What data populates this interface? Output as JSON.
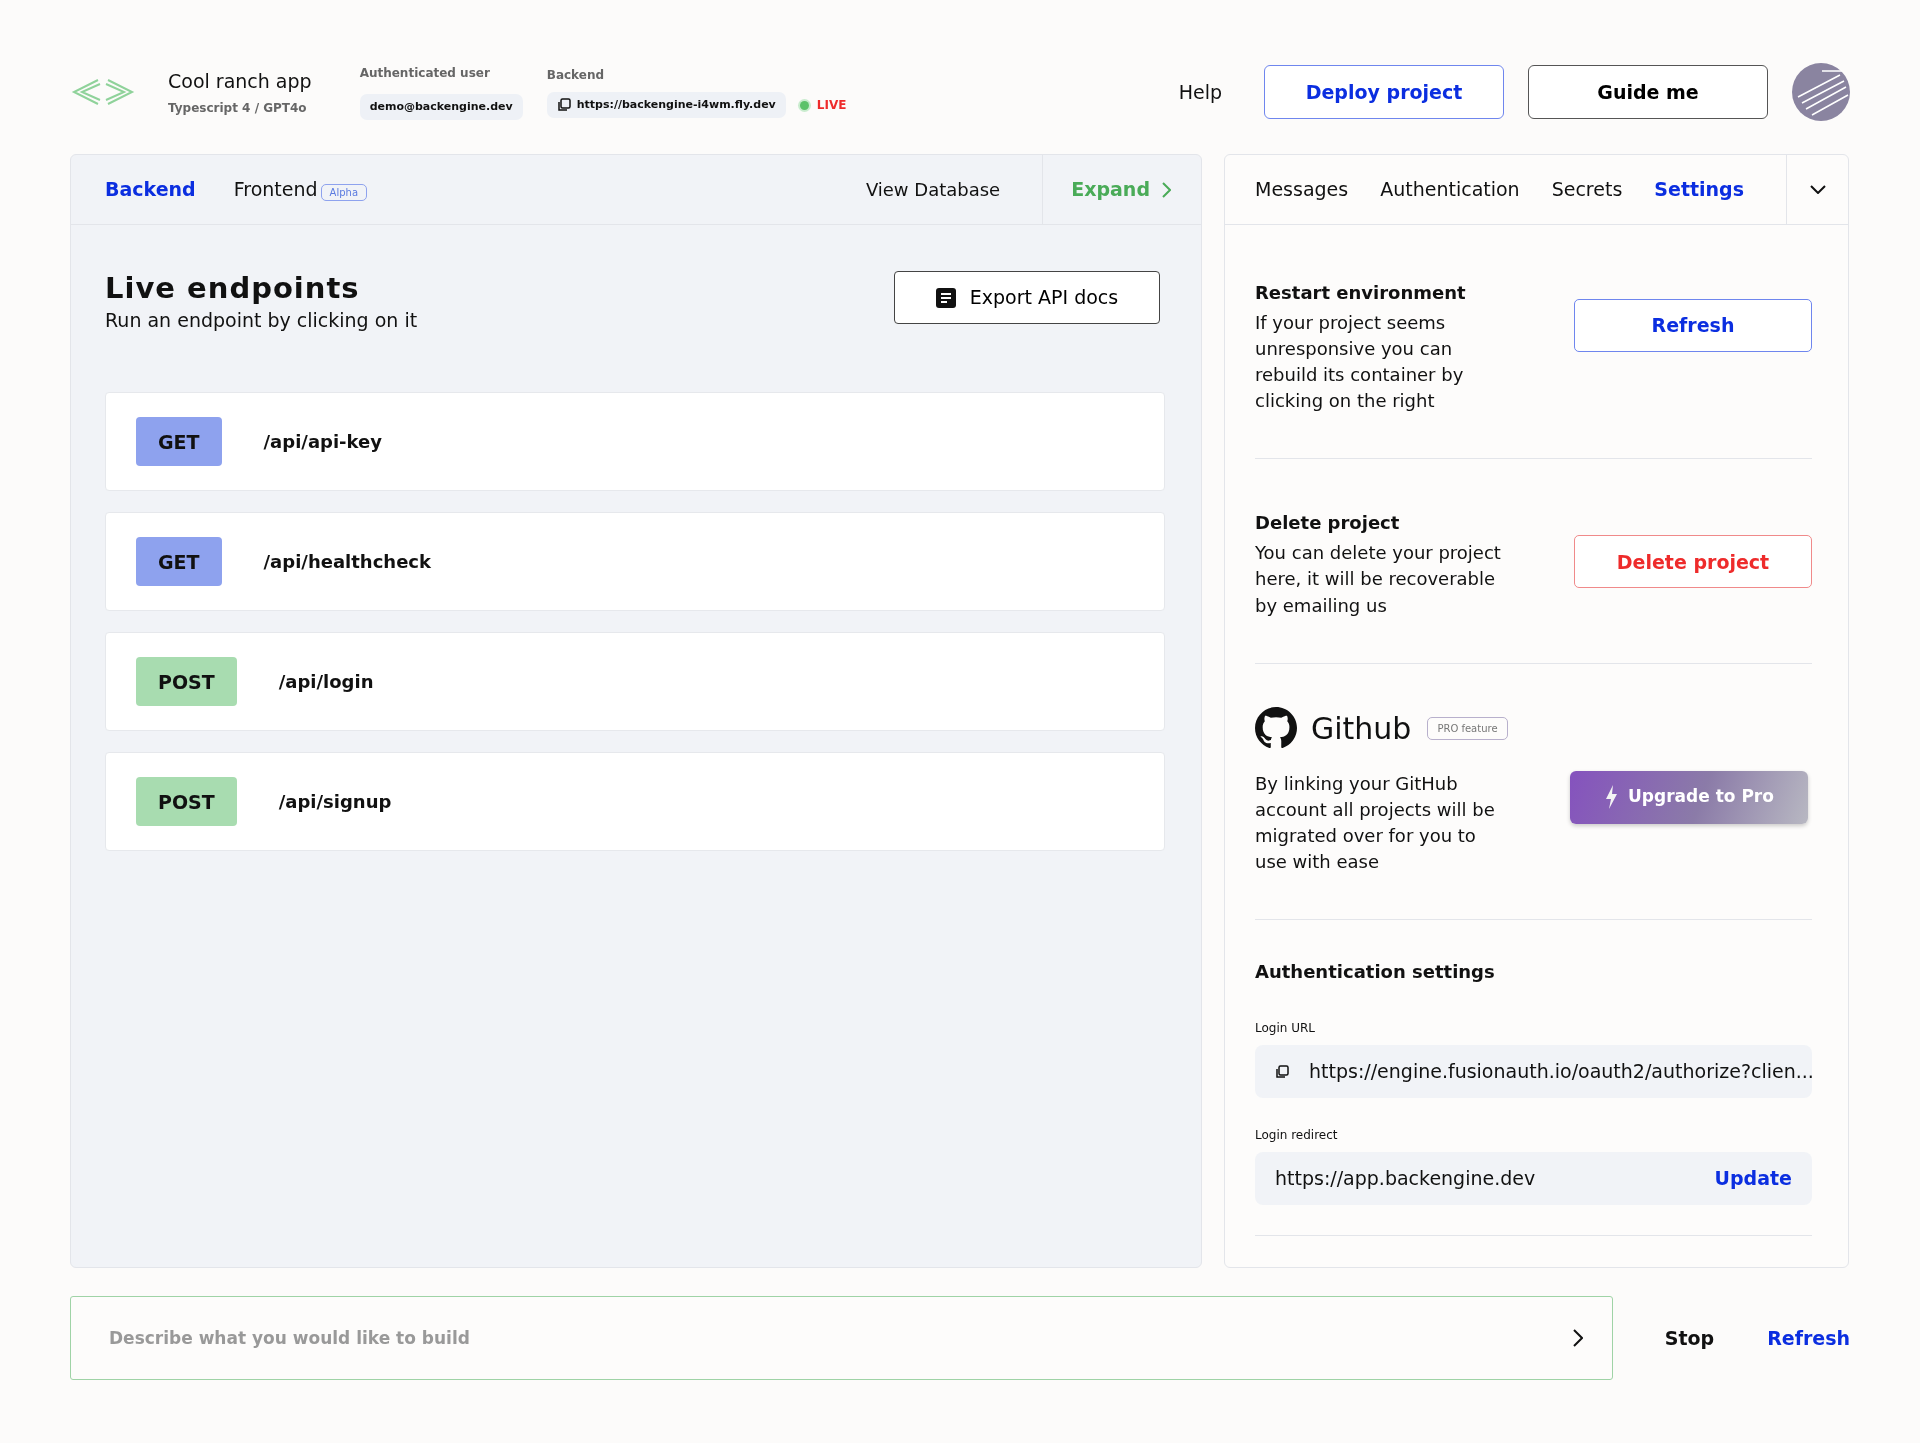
{
  "header": {
    "app_name": "Cool ranch app",
    "app_subtitle": "Typescript 4 / GPT4o",
    "user_label": "Authenticated user",
    "user_email": "demo@backengine.dev",
    "backend_label": "Backend",
    "backend_url": "https://backengine-i4wm.fly.dev",
    "live": true,
    "live_label": "LIVE",
    "help": "Help",
    "deploy_button": "Deploy project",
    "guide_button": "Guide me"
  },
  "left_panel": {
    "tabs": [
      {
        "label": "Backend",
        "selected": true
      },
      {
        "label": "Frontend",
        "badge": "Alpha",
        "selected": false
      }
    ],
    "view_database": "View Database",
    "expand": "Expand",
    "title": "Live endpoints",
    "subtitle": "Run an endpoint by clicking on it",
    "export_button": "Export API docs",
    "endpoints": [
      {
        "method": "GET",
        "path": "/api/api-key",
        "color": "#8ea2ee"
      },
      {
        "method": "GET",
        "path": "/api/healthcheck",
        "color": "#8ea2ee"
      },
      {
        "method": "POST",
        "path": "/api/login",
        "color": "#a8dcb0"
      },
      {
        "method": "POST",
        "path": "/api/signup",
        "color": "#a8dcb0"
      }
    ]
  },
  "right_panel": {
    "tabs": [
      {
        "label": "Messages",
        "selected": false
      },
      {
        "label": "Authentication",
        "selected": false
      },
      {
        "label": "Secrets",
        "selected": false
      },
      {
        "label": "Settings",
        "selected": true
      }
    ],
    "sections": [
      {
        "kind": "restart",
        "title": "Restart environment",
        "text": "If your project seems unresponsive you can rebuild its container by clicking on the right",
        "button": "Refresh"
      },
      {
        "kind": "delete",
        "title": "Delete project",
        "text": "You can delete your project here, it will be recoverable by emailing us",
        "button": "Delete project"
      },
      {
        "kind": "github",
        "title": "Github",
        "badge": "PRO feature",
        "text": "By linking your GitHub account all projects will be migrated over for you to use with ease",
        "button": "Upgrade to Pro"
      },
      {
        "kind": "auth",
        "title": "Authentication settings",
        "login_url_label": "Login URL",
        "login_url": "https://engine.fusionauth.io/oauth2/authorize?clien...",
        "login_redirect_label": "Login redirect",
        "login_redirect": "https://app.backengine.dev",
        "update": "Update"
      }
    ]
  },
  "prompt": {
    "placeholder": "Describe what you would like to build",
    "stop": "Stop",
    "refresh": "Refresh"
  }
}
